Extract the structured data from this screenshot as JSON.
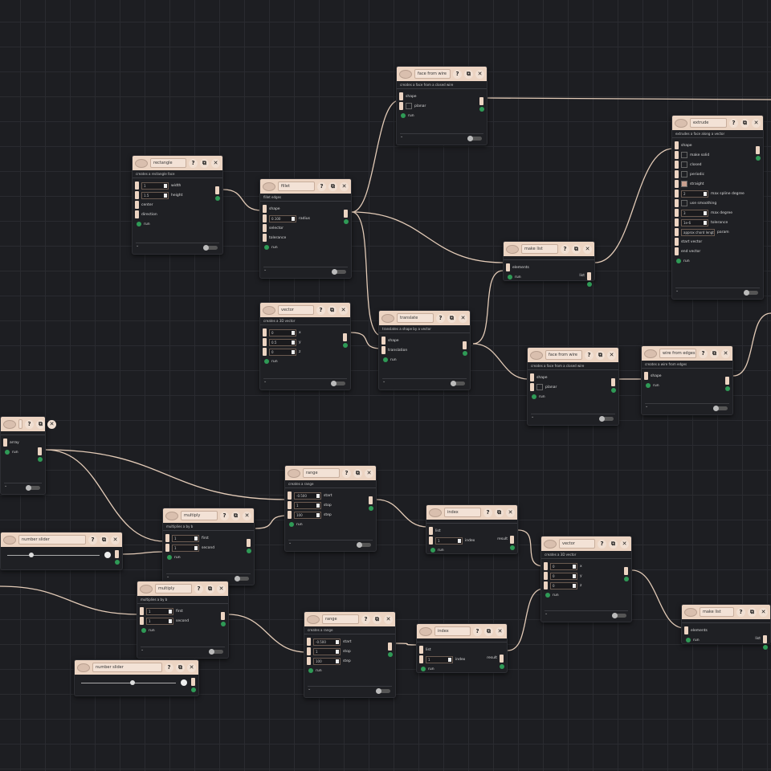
{
  "colors": {
    "background": "#1d1e22",
    "header": "#ecd4c2",
    "port": "#ecd4c2",
    "run_port": "#2f9a56",
    "wire": "#e3cbb7"
  },
  "header_buttons": [
    "?",
    "⧉",
    "✕"
  ],
  "run_label": "run",
  "nodes": [
    {
      "title": "rectangle",
      "subtitle": "creates a rectangle face",
      "rows": [
        {
          "t": "input",
          "v": "1",
          "l": "width"
        },
        {
          "t": "input",
          "v": "1.5",
          "l": "height"
        },
        {
          "t": "label",
          "l": "center"
        },
        {
          "t": "label",
          "l": "direction"
        }
      ]
    },
    {
      "title": "fillet",
      "subtitle": "fillet edges",
      "rows": [
        {
          "t": "label",
          "l": "shape"
        },
        {
          "t": "input",
          "v": "0.100",
          "l": "radius"
        },
        {
          "t": "label",
          "l": "selector"
        },
        {
          "t": "label",
          "l": "tolerance"
        }
      ]
    },
    {
      "title": "face from wire",
      "subtitle": "creates a face from a closed wire",
      "rows": [
        {
          "t": "label",
          "l": "shape"
        },
        {
          "t": "check",
          "on": false,
          "l": "planar"
        }
      ]
    },
    {
      "title": "extrude",
      "subtitle": "extrudes a face along a vector",
      "rows": [
        {
          "t": "label",
          "l": "shape"
        },
        {
          "t": "check",
          "on": false,
          "l": "make solid"
        },
        {
          "t": "check",
          "on": false,
          "l": "closed"
        },
        {
          "t": "check",
          "on": false,
          "l": "periodic"
        },
        {
          "t": "check",
          "on": true,
          "l": "straight"
        },
        {
          "t": "input",
          "v": "2",
          "l": "max spline degree"
        },
        {
          "t": "check",
          "on": false,
          "l": "use smoothing"
        },
        {
          "t": "input",
          "v": "3",
          "l": "max degree"
        },
        {
          "t": "input",
          "v": "1e-6",
          "l": "tolerance"
        },
        {
          "t": "select",
          "v": "approx chord length",
          "l": "param"
        },
        {
          "t": "label",
          "l": "start vector"
        },
        {
          "t": "label",
          "l": "end vector"
        }
      ]
    },
    {
      "title": "make list",
      "subtitle": "",
      "rows": [
        {
          "t": "label",
          "l": "elements"
        }
      ],
      "out": "list"
    },
    {
      "title": "vector",
      "subtitle": "creates a 3D vector",
      "rows": [
        {
          "t": "input",
          "v": "0",
          "l": "x"
        },
        {
          "t": "input",
          "v": "0.5",
          "l": "y"
        },
        {
          "t": "input",
          "v": "0",
          "l": "z"
        }
      ]
    },
    {
      "title": "translate",
      "subtitle": "translates a shape by a vector",
      "rows": [
        {
          "t": "label",
          "l": "shape"
        },
        {
          "t": "label",
          "l": "translation"
        }
      ]
    },
    {
      "title": "face from wire",
      "subtitle": "creates a face from a closed wire",
      "rows": [
        {
          "t": "label",
          "l": "shape"
        },
        {
          "t": "check",
          "on": false,
          "l": "planar"
        }
      ]
    },
    {
      "title": "wire from edges",
      "subtitle": "creates a wire from edges",
      "rows": [
        {
          "t": "label",
          "l": "shape"
        }
      ]
    },
    {
      "title": "",
      "subtitle": "",
      "rows": [
        {
          "t": "label",
          "l": "array"
        }
      ]
    },
    {
      "title": "range",
      "subtitle": "creates a range",
      "rows": [
        {
          "t": "input",
          "v": "-0.500",
          "l": "start"
        },
        {
          "t": "input",
          "v": "1",
          "l": "stop"
        },
        {
          "t": "input",
          "v": "100",
          "l": "step"
        }
      ]
    },
    {
      "title": "multiply",
      "subtitle": "multiplies a by b",
      "rows": [
        {
          "t": "input",
          "v": "1",
          "l": "first"
        },
        {
          "t": "input",
          "v": "1",
          "l": "second"
        }
      ]
    },
    {
      "title": "number slider",
      "slider": 0.25
    },
    {
      "title": "index",
      "subtitle": "",
      "rows": [
        {
          "t": "label",
          "l": "list"
        },
        {
          "t": "input",
          "v": "1",
          "l": "index"
        }
      ],
      "out": "result"
    },
    {
      "title": "vector",
      "subtitle": "creates a 3D vector",
      "rows": [
        {
          "t": "input",
          "v": "0",
          "l": "x"
        },
        {
          "t": "input",
          "v": "0",
          "l": "y"
        },
        {
          "t": "input",
          "v": "0",
          "l": "z"
        }
      ]
    },
    {
      "title": "multiply",
      "subtitle": "multiplies a by b",
      "rows": [
        {
          "t": "input",
          "v": "1",
          "l": "first"
        },
        {
          "t": "input",
          "v": "1",
          "l": "second"
        }
      ]
    },
    {
      "title": "number slider",
      "slider": 0.55
    },
    {
      "title": "range",
      "subtitle": "creates a range",
      "rows": [
        {
          "t": "input",
          "v": "-0.500",
          "l": "start"
        },
        {
          "t": "input",
          "v": "1",
          "l": "stop"
        },
        {
          "t": "input",
          "v": "100",
          "l": "step"
        }
      ]
    },
    {
      "title": "index",
      "subtitle": "",
      "rows": [
        {
          "t": "label",
          "l": "list"
        },
        {
          "t": "input",
          "v": "1",
          "l": "index"
        }
      ],
      "out": "result"
    },
    {
      "title": "make list",
      "subtitle": "",
      "rows": [
        {
          "t": "label",
          "l": "elements"
        }
      ],
      "out": "list"
    }
  ]
}
